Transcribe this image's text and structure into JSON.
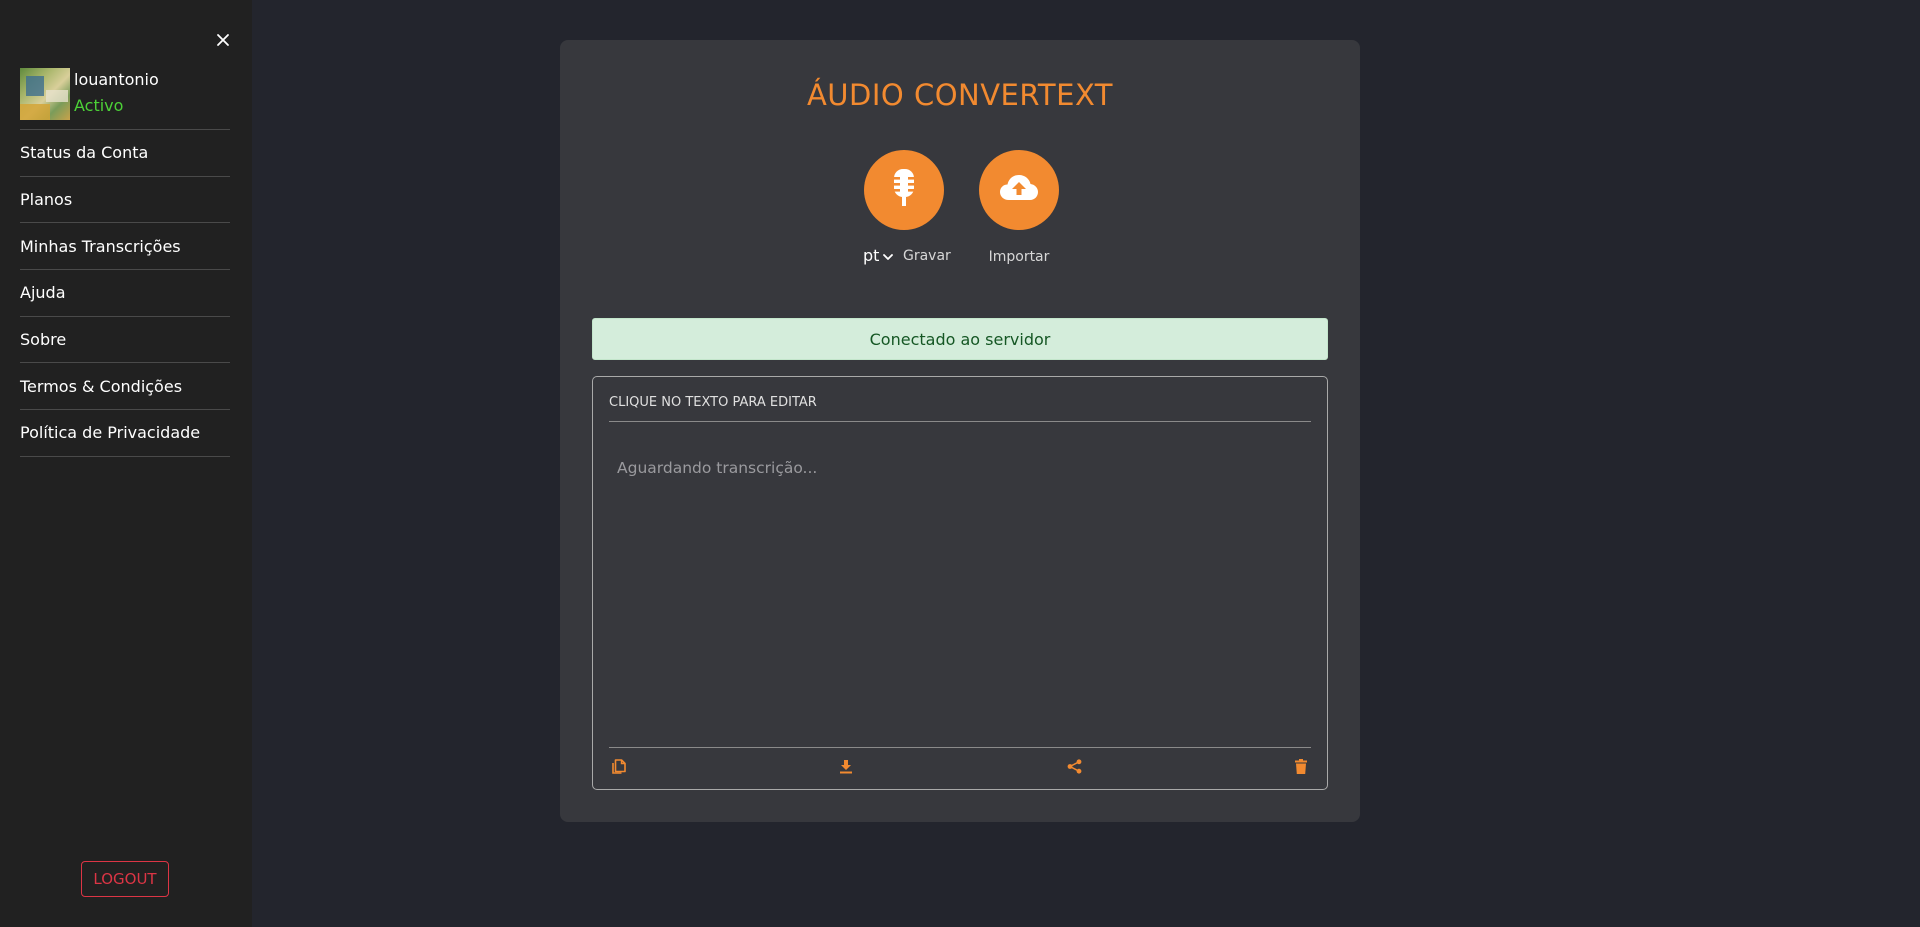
{
  "colors": {
    "accent": "#f28a30",
    "status_active": "#4cd137",
    "danger": "#dc3545",
    "alert_bg": "#d4eddb",
    "alert_text": "#155724"
  },
  "sidebar": {
    "close_icon": "close-icon",
    "user": {
      "name": "louantonio",
      "status": "Activo"
    },
    "items": [
      {
        "label": "Status da Conta"
      },
      {
        "label": "Planos"
      },
      {
        "label": "Minhas Transcrições"
      },
      {
        "label": "Ajuda"
      },
      {
        "label": "Sobre"
      },
      {
        "label": "Termos & Condições"
      },
      {
        "label": "Política de Privacidade"
      }
    ],
    "logout_label": "LOGOUT"
  },
  "main": {
    "title": "ÁUDIO CONVERTEXT",
    "record": {
      "icon": "microphone-icon",
      "language": "pt",
      "label": "Gravar"
    },
    "import": {
      "icon": "cloud-upload-icon",
      "label": "Importar"
    },
    "alert": "Conectado ao servidor",
    "editor": {
      "header": "CLIQUE NO TEXTO PARA EDITAR",
      "placeholder": "Aguardando transcrição...",
      "tools": [
        "copy-icon",
        "download-icon",
        "share-icon",
        "trash-icon"
      ]
    }
  }
}
